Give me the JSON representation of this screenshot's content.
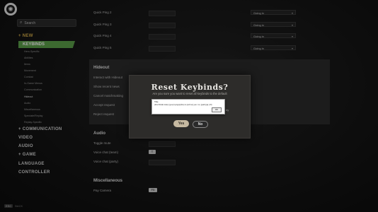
{
  "sidebar": {
    "search_label": "Search",
    "items": [
      {
        "label": "+ NEW",
        "top": 0
      },
      {
        "label": "KEYBINDS"
      },
      {
        "label": "+ COMMUNICATION"
      },
      {
        "label": "VIDEO"
      },
      {
        "label": "AUDIO"
      },
      {
        "label": "+ GAME"
      },
      {
        "label": "LANGUAGE"
      },
      {
        "label": "CONTROLLER"
      }
    ],
    "subitems": [
      "Hero-Specific",
      "Abilities",
      "Items",
      "Movement",
      "Combat",
      "In-Game Menus",
      "Communication",
      "Hideout",
      "Audio",
      "Miscellaneous",
      "Spectate/Replay",
      "Replay-Specific"
    ],
    "footer_key": "ESC",
    "footer_label": "BACK"
  },
  "keybinds": {
    "quick_ping_rows": [
      {
        "label": "Quick Ping 2",
        "value": "Going in"
      },
      {
        "label": "Quick Ping 3",
        "value": "Going in"
      },
      {
        "label": "Quick Ping 4",
        "value": "Going in"
      },
      {
        "label": "Quick Ping 5",
        "value": "Going in"
      }
    ],
    "hideout_title": "Hideout",
    "hideout_rows": [
      "Interact with Hideout",
      "Show recent news",
      "Cancel matchmaking",
      "Accept request",
      "Reject request"
    ],
    "audio_title": "Audio",
    "audio_rows": [
      "Toggle mute",
      "Voice chat (team)",
      "Voice chat (party)"
    ],
    "voice_team_key": "T",
    "misc_title": "Miscellaneous",
    "misc_row": "Pay Camera",
    "misc_key": "F5"
  },
  "modal": {
    "title": "Reset Keybinds?",
    "text": "Are you sure you want to reset all keybinds to the default",
    "yes_label": "Yes",
    "no_label": "No",
    "behind_left": "Key",
    "behind_right": "dy"
  },
  "alert": {
    "title": "Title",
    "message": "(this PAGE index) [yes] tryApply(this) to [rel=no] yes / no; [path] [a] (t 8)",
    "ok_label": "OK"
  }
}
